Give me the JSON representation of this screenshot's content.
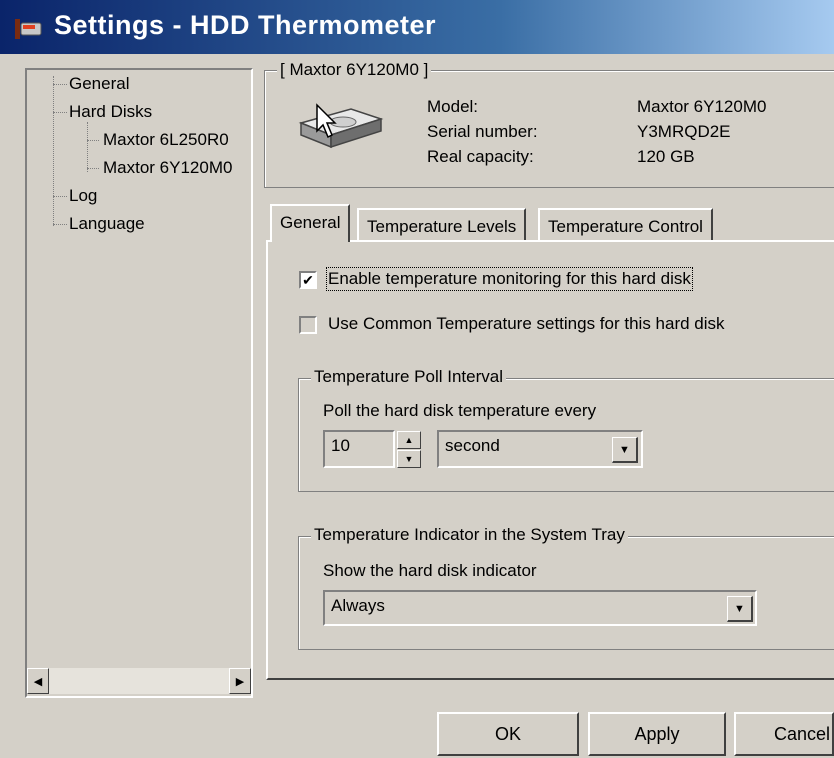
{
  "window": {
    "title": "Settings - HDD Thermometer",
    "icon": "thermometer-icon"
  },
  "tree": {
    "items": [
      {
        "label": "General"
      },
      {
        "label": "Hard Disks"
      },
      {
        "label": "Maxtor 6L250R0"
      },
      {
        "label": "Maxtor 6Y120M0"
      },
      {
        "label": "Log"
      },
      {
        "label": "Language"
      }
    ],
    "selected": "Maxtor 6Y120M0"
  },
  "disk_info": {
    "group_title": "[ Maxtor 6Y120M0 ]",
    "icon": "hard-disk-icon",
    "model_label": "Model:",
    "model_value": "Maxtor 6Y120M0",
    "serial_label": "Serial number:",
    "serial_value": "Y3MRQD2E",
    "capacity_label": "Real capacity:",
    "capacity_value": "120 GB"
  },
  "tabs": [
    {
      "label": "General",
      "active": true
    },
    {
      "label": "Temperature Levels",
      "active": false
    },
    {
      "label": "Temperature Control",
      "active": false
    }
  ],
  "general_tab": {
    "enable_monitoring": {
      "label": "Enable temperature monitoring for this hard disk",
      "checked": true
    },
    "use_common": {
      "label": "Use Common Temperature settings for this hard disk",
      "checked": false
    },
    "poll_group": {
      "title": "Temperature Poll Interval",
      "caption": "Poll the hard disk temperature every",
      "interval_value": "10",
      "unit_selected": "second"
    },
    "tray_group": {
      "title": "Temperature Indicator in the System Tray",
      "caption": "Show the hard disk indicator",
      "selected": "Always"
    }
  },
  "buttons": {
    "ok": "OK",
    "apply": "Apply",
    "cancel": "Cancel"
  },
  "glyphs": {
    "check": "✔",
    "arrow_up": "▲",
    "arrow_down": "▼",
    "arrow_left": "◀",
    "arrow_right": "▶"
  }
}
